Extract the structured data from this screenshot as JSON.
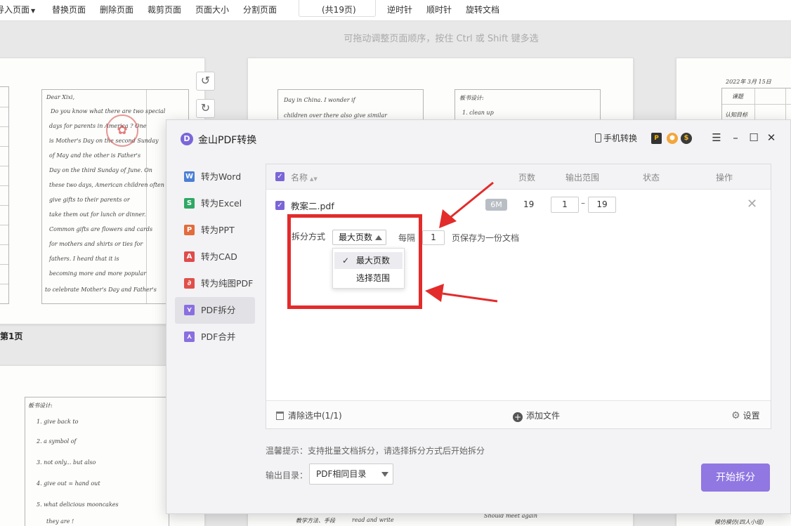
{
  "toolbar": {
    "items": [
      "导入页面",
      "替换页面",
      "删除页面",
      "裁剪页面",
      "页面大小",
      "分割页面"
    ],
    "page_count": "(共19页)",
    "rotate_ccw": "逆时针",
    "rotate_cw": "顺时针",
    "rotate_doc": "旋转文档"
  },
  "hint": "可拖动调整页面顺序，按住 Ctrl 或 Shift 键多选",
  "page_label": "第1页",
  "thumb_text": {
    "p1": [
      "Dear Xixi,",
      "Do you know what there are two special",
      "days for parents in America ? One",
      "is Mother's Day on the second Sunday",
      "of May and the other is Father's",
      "Day on the third Sunday of June. On",
      "these two days, American children often",
      "give gifts to their parents or",
      "take them out for lunch or dinner.",
      "Common gifts are flowers and cards",
      "for mothers and shirts or ties for",
      "fathers. I heard that it is",
      "becoming more and more popular",
      "to celebrate Mother's Day and Father's"
    ],
    "p2": [
      "Day in China. I wonder if",
      "children over there also give similar",
      "板书设计:",
      "1. clean up"
    ],
    "p3": [
      "2022年 3月 15日",
      "课题",
      "认知目标"
    ],
    "p4": [
      "板书设计:",
      "1. give back to",
      "2. a symbol of",
      "3. not only... but also",
      "4. give out = hand out",
      "5. what delicious mooncakes",
      "they are !"
    ],
    "p5": [
      "教学方法、手段",
      "read and write",
      "Should meet again",
      "模仿模仿(四人小组)"
    ]
  },
  "dialog": {
    "title": "金山PDF转换",
    "mobile_convert": "手机转换",
    "window_controls": [
      "menu-icon",
      "minimize-icon",
      "maximize-icon",
      "close-icon"
    ]
  },
  "sidebar": [
    {
      "label": "转为Word",
      "icon": "W",
      "color": "#4a7fd6"
    },
    {
      "label": "转为Excel",
      "icon": "S",
      "color": "#2fa866"
    },
    {
      "label": "转为PPT",
      "icon": "P",
      "color": "#e36b3c"
    },
    {
      "label": "转为CAD",
      "icon": "A",
      "color": "#e04b4b"
    },
    {
      "label": "转为纯图PDF",
      "icon": "∂",
      "color": "#e0504a"
    },
    {
      "label": "PDF拆分",
      "icon": "⋎",
      "color": "#8a6fe0"
    },
    {
      "label": "PDF合并",
      "icon": "⋏",
      "color": "#8a6fe0"
    }
  ],
  "table": {
    "headers": {
      "name": "名称",
      "pages": "页数",
      "range": "输出范围",
      "status": "状态",
      "action": "操作"
    },
    "file": {
      "name": "教案二.pdf",
      "size": "6M",
      "pages": "19",
      "range_from": "1",
      "range_to": "19"
    }
  },
  "split": {
    "mode_label": "拆分方式",
    "mode_value": "最大页数",
    "every_label": "每隔",
    "every_value": "1",
    "every_suffix": "页保存为一份文档",
    "options": [
      "最大页数",
      "选择范围"
    ]
  },
  "footer": {
    "clear": "清除选中(1/1)",
    "add": "添加文件",
    "settings": "设置"
  },
  "tip": "温馨提示：支持批量文档拆分，请选择拆分方式后开始拆分",
  "output": {
    "label": "输出目录：",
    "value": "PDF相同目录"
  },
  "start_button": "开始拆分",
  "colors": {
    "accent": "#9077e2",
    "annotation": "#e32b2b"
  }
}
